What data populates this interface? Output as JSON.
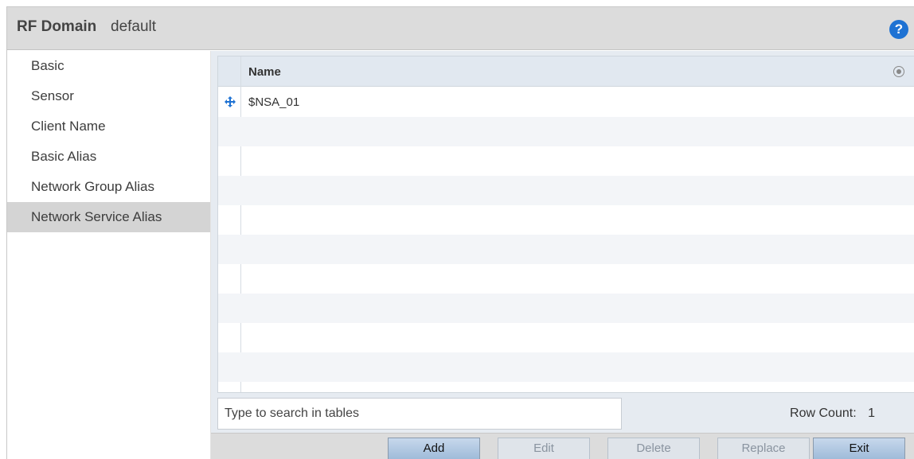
{
  "header": {
    "title": "RF Domain",
    "subtitle": "default"
  },
  "sidebar": {
    "items": [
      {
        "label": "Basic"
      },
      {
        "label": "Sensor"
      },
      {
        "label": "Client Name"
      },
      {
        "label": "Basic Alias"
      },
      {
        "label": "Network Group Alias"
      },
      {
        "label": "Network Service Alias",
        "active": true
      }
    ]
  },
  "table": {
    "columns": [
      "Name"
    ],
    "rows": [
      {
        "name": "$NSA_01"
      }
    ]
  },
  "search": {
    "placeholder": "Type to search in tables"
  },
  "row_count": {
    "label": "Row Count:",
    "value": "1"
  },
  "buttons": {
    "add": "Add",
    "edit": "Edit",
    "delete": "Delete",
    "replace": "Replace",
    "exit": "Exit"
  },
  "colors": {
    "accent": "#1e72d3",
    "row_marker": "#1e72d3",
    "active_sidebar": "#d4d4d4"
  }
}
